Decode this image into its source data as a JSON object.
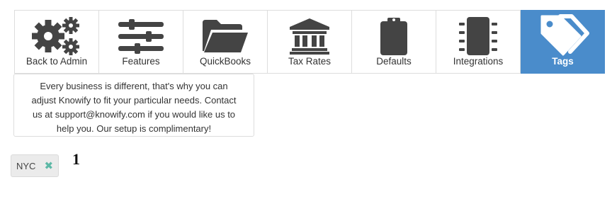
{
  "toolbar": {
    "items": [
      {
        "label": "Back to Admin",
        "icon": "gears-icon",
        "active": false
      },
      {
        "label": "Features",
        "icon": "sliders-icon",
        "active": false
      },
      {
        "label": "QuickBooks",
        "icon": "folder-icon",
        "active": false
      },
      {
        "label": "Tax Rates",
        "icon": "bank-icon",
        "active": false
      },
      {
        "label": "Defaults",
        "icon": "clipboard-icon",
        "active": false
      },
      {
        "label": "Integrations",
        "icon": "chip-icon",
        "active": false
      },
      {
        "label": "Tags",
        "icon": "tags-icon",
        "active": true
      }
    ],
    "active_color": "#4a8ccb",
    "icon_color": "#444444"
  },
  "info": {
    "line1": "Every business is different, that's why you can",
    "line2": "adjust Knowify to fit your particular needs. Contact",
    "line3": "us at support@knowify.com if you would like us to",
    "line4": "help you. Our setup is complimentary!"
  },
  "tags": {
    "items": [
      {
        "label": "NYC",
        "remove_glyph": "✖"
      }
    ],
    "count": "1"
  }
}
